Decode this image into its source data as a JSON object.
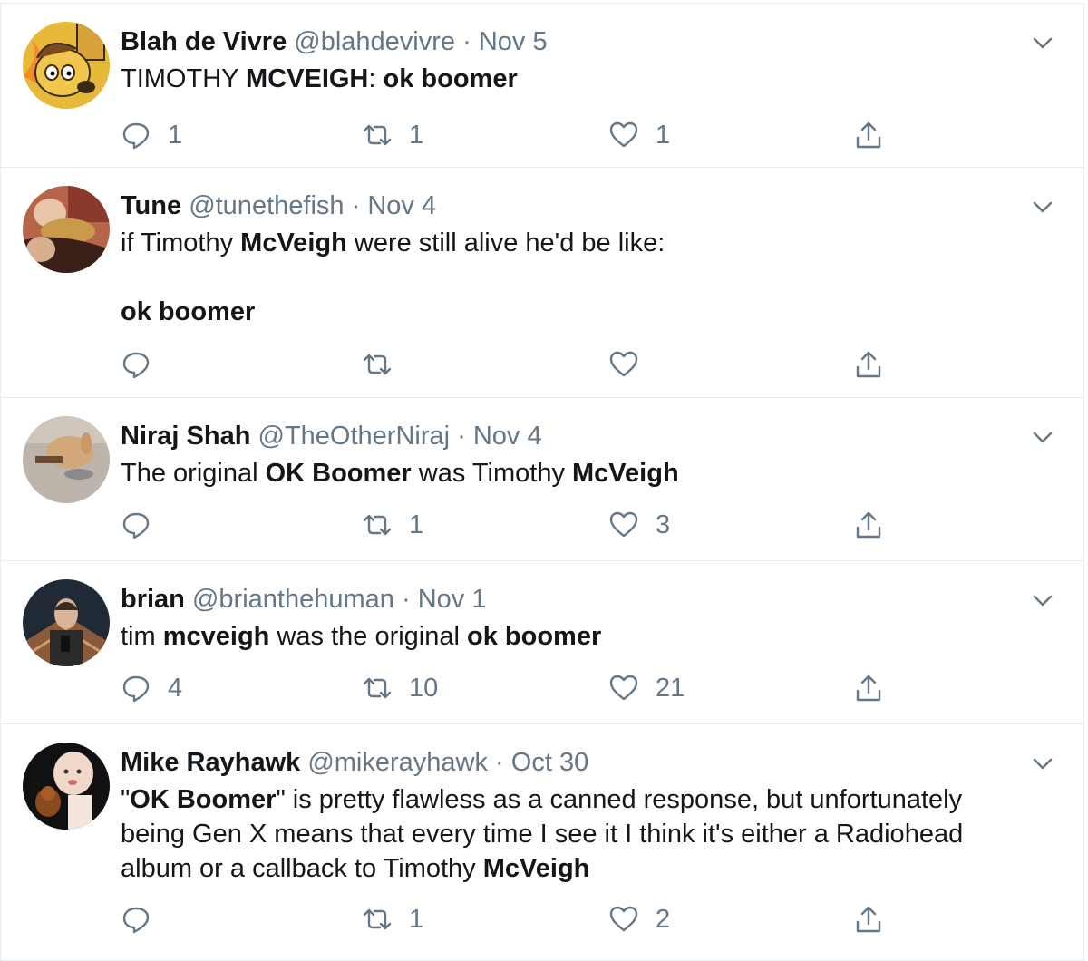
{
  "tweets": [
    {
      "name": "Blah de Vivre",
      "handle": "@blahdevivre",
      "date": "Nov 5",
      "avatar_icon": "this-is-fine-dog-avatar",
      "lines": [
        [
          {
            "t": "TIMOTHY "
          },
          {
            "t": "MCVEIGH",
            "b": true
          },
          {
            "t": ": "
          },
          {
            "t": "ok boomer",
            "b": true
          }
        ]
      ],
      "replies": "1",
      "retweets": "1",
      "likes": "1"
    },
    {
      "name": "Tune",
      "handle": "@tunethefish",
      "date": "Nov 4",
      "avatar_icon": "person-with-dog-avatar",
      "lines": [
        [
          {
            "t": "if Timothy "
          },
          {
            "t": "McVeigh",
            "b": true
          },
          {
            "t": " were still alive he'd be like:"
          }
        ],
        [],
        [
          {
            "t": "ok boomer",
            "b": true
          }
        ]
      ],
      "replies": "",
      "retweets": "",
      "likes": ""
    },
    {
      "name": "Niraj Shah",
      "handle": "@TheOtherNiraj",
      "date": "Nov 4",
      "avatar_icon": "rabbit-avatar",
      "lines": [
        [
          {
            "t": "The original "
          },
          {
            "t": "OK Boomer",
            "b": true
          },
          {
            "t": " was Timothy "
          },
          {
            "t": "McVeigh",
            "b": true
          }
        ]
      ],
      "replies": "",
      "retweets": "1",
      "likes": "3"
    },
    {
      "name": "brian",
      "handle": "@brianthehuman",
      "date": "Nov 1",
      "avatar_icon": "man-with-phone-avatar",
      "lines": [
        [
          {
            "t": "tim "
          },
          {
            "t": "mcveigh",
            "b": true
          },
          {
            "t": " was the original "
          },
          {
            "t": "ok boomer",
            "b": true
          }
        ]
      ],
      "replies": "4",
      "retweets": "10",
      "likes": "21"
    },
    {
      "name": "Mike Rayhawk",
      "handle": "@mikerayhawk",
      "date": "Oct 30",
      "avatar_icon": "baby-with-monkey-avatar",
      "lines": [
        [
          {
            "t": "\""
          },
          {
            "t": "OK Boomer",
            "b": true
          },
          {
            "t": "\" is pretty flawless as a canned response, but unfortunately"
          }
        ],
        [
          {
            "t": "being Gen X means that every time I see it I think it's either a Radiohead"
          }
        ],
        [
          {
            "t": "album or a callback to Timothy "
          },
          {
            "t": "McVeigh",
            "b": true
          }
        ]
      ],
      "replies": "",
      "retweets": "1",
      "likes": "2"
    }
  ],
  "separator": "·",
  "icons": {
    "reply": "reply-icon",
    "retweet": "retweet-icon",
    "like": "like-icon",
    "share": "share-icon",
    "chevron": "chevron-down-icon"
  },
  "colors": {
    "text": "#14171a",
    "muted": "#657786",
    "border": "#e6ecf0"
  }
}
